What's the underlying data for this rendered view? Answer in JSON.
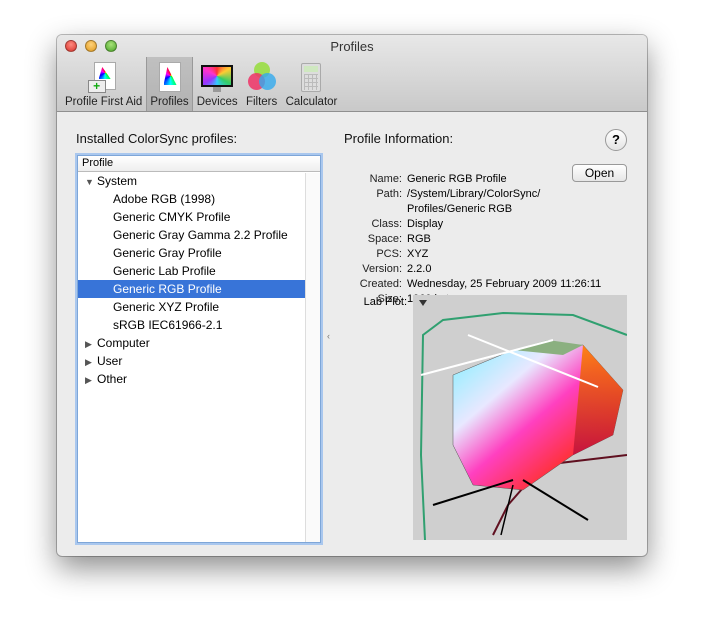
{
  "window": {
    "title": "Profiles"
  },
  "toolbar": {
    "items": [
      {
        "label": "Profile First Aid",
        "icon": "profile-first-aid-icon"
      },
      {
        "label": "Profiles",
        "icon": "profiles-icon",
        "selected": true
      },
      {
        "label": "Devices",
        "icon": "devices-icon"
      },
      {
        "label": "Filters",
        "icon": "filters-icon"
      },
      {
        "label": "Calculator",
        "icon": "calculator-icon"
      }
    ]
  },
  "left": {
    "heading": "Installed ColorSync profiles:",
    "column": "Profile",
    "rows": [
      {
        "label": "System",
        "level": 0,
        "expanded": true
      },
      {
        "label": "Adobe RGB (1998)",
        "level": 1
      },
      {
        "label": "Generic CMYK Profile",
        "level": 1
      },
      {
        "label": "Generic Gray Gamma 2.2 Profile",
        "level": 1
      },
      {
        "label": "Generic Gray Profile",
        "level": 1
      },
      {
        "label": "Generic Lab Profile",
        "level": 1
      },
      {
        "label": "Generic RGB Profile",
        "level": 1,
        "selected": true
      },
      {
        "label": "Generic XYZ Profile",
        "level": 1
      },
      {
        "label": "sRGB IEC61966-2.1",
        "level": 1
      },
      {
        "label": "Computer",
        "level": 0,
        "expanded": false
      },
      {
        "label": "User",
        "level": 0,
        "expanded": false
      },
      {
        "label": "Other",
        "level": 0,
        "expanded": false
      }
    ]
  },
  "info": {
    "heading": "Profile Information:",
    "help": "?",
    "open_button": "Open",
    "fields": [
      {
        "label": "Name:",
        "value": "Generic RGB Profile"
      },
      {
        "label": "Path:",
        "value": "/System/Library/ColorSync/ Profiles/Generic RGB"
      },
      {
        "label": "Class:",
        "value": "Display"
      },
      {
        "label": "Space:",
        "value": "RGB"
      },
      {
        "label": "PCS:",
        "value": "XYZ"
      },
      {
        "label": "Version:",
        "value": "2.2.0"
      },
      {
        "label": "Created:",
        "value": "Wednesday, 25 February 2009 11:26:11"
      },
      {
        "label": "Size:",
        "value": "1960 bytes"
      }
    ],
    "lab_plot_label": "Lab Plot:"
  },
  "colors": {
    "selection": "#3874d8",
    "focus": "#7ea6d8"
  }
}
